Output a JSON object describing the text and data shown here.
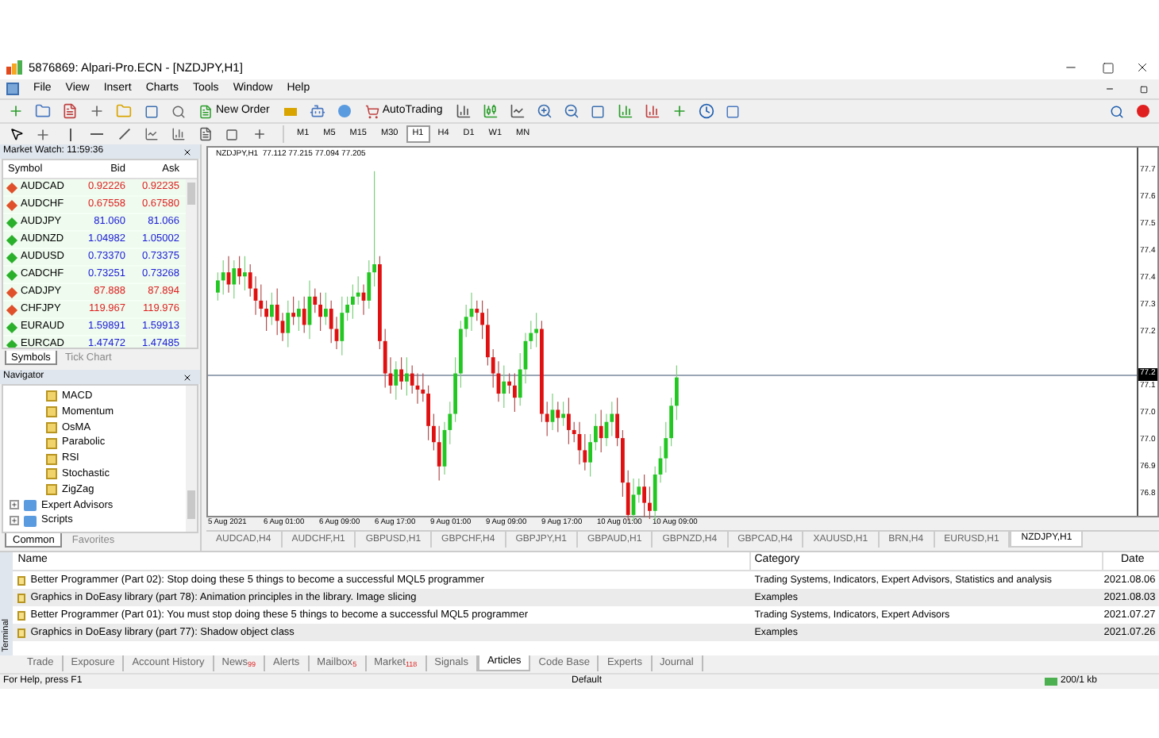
{
  "window": {
    "title": "5876869: Alpari-Pro.ECN - [NZDJPY,H1]"
  },
  "menu": [
    "File",
    "View",
    "Insert",
    "Charts",
    "Tools",
    "Window",
    "Help"
  ],
  "toolbar": {
    "buttons": [
      "New Order",
      "AutoTrading"
    ]
  },
  "timeframes": [
    {
      "label": "M1",
      "selected": false
    },
    {
      "label": "M5",
      "selected": false
    },
    {
      "label": "M15",
      "selected": false
    },
    {
      "label": "M30",
      "selected": false
    },
    {
      "label": "H1",
      "selected": true
    },
    {
      "label": "H4",
      "selected": false
    },
    {
      "label": "D1",
      "selected": false
    },
    {
      "label": "W1",
      "selected": false
    },
    {
      "label": "MN",
      "selected": false
    }
  ],
  "market_watch": {
    "title": "Market Watch: 11:59:36",
    "columns": [
      "Symbol",
      "Bid",
      "Ask"
    ],
    "rows": [
      {
        "symbol": "AUDCAD",
        "bid": "0.92226",
        "ask": "0.92235",
        "rising": false
      },
      {
        "symbol": "AUDCHF",
        "bid": "0.67558",
        "ask": "0.67580",
        "rising": false
      },
      {
        "symbol": "AUDJPY",
        "bid": "81.060",
        "ask": "81.066",
        "rising": true
      },
      {
        "symbol": "AUDNZD",
        "bid": "1.04982",
        "ask": "1.05002",
        "rising": true
      },
      {
        "symbol": "AUDUSD",
        "bid": "0.73370",
        "ask": "0.73375",
        "rising": true
      },
      {
        "symbol": "CADCHF",
        "bid": "0.73251",
        "ask": "0.73268",
        "rising": true
      },
      {
        "symbol": "CADJPY",
        "bid": "87.888",
        "ask": "87.894",
        "rising": false
      },
      {
        "symbol": "CHFJPY",
        "bid": "119.967",
        "ask": "119.976",
        "rising": false
      },
      {
        "symbol": "EURAUD",
        "bid": "1.59891",
        "ask": "1.59913",
        "rising": true
      },
      {
        "symbol": "EURCAD",
        "bid": "1.47472",
        "ask": "1.47485",
        "rising": true
      }
    ],
    "tabs": [
      {
        "label": "Symbols",
        "selected": true
      },
      {
        "label": "Tick Chart",
        "selected": false
      }
    ]
  },
  "navigator": {
    "title": "Navigator",
    "items": [
      {
        "label": "MACD",
        "kind": "indicator"
      },
      {
        "label": "Momentum",
        "kind": "indicator"
      },
      {
        "label": "OsMA",
        "kind": "indicator"
      },
      {
        "label": "Parabolic",
        "kind": "indicator"
      },
      {
        "label": "RSI",
        "kind": "indicator"
      },
      {
        "label": "Stochastic",
        "kind": "indicator"
      },
      {
        "label": "ZigZag",
        "kind": "indicator"
      },
      {
        "label": "Expert Advisors",
        "kind": "folder",
        "expanded": false
      },
      {
        "label": "Scripts",
        "kind": "folder",
        "expanded": false
      }
    ],
    "tabs": [
      {
        "label": "Common",
        "selected": true
      },
      {
        "label": "Favorites",
        "selected": false
      }
    ]
  },
  "chart": {
    "legend": "NZDJPY,H1  77.112 77.215 77.094 77.205",
    "price_labels": [
      "77.7",
      "77.6",
      "77.5",
      "77.4",
      "77.4",
      "77.3",
      "77.2",
      "77.1",
      "77.0",
      "77.0",
      "76.9",
      "76.8"
    ],
    "current_price": "77.2",
    "time_labels": [
      "5 Aug 2021",
      "6 Aug 01:00",
      "6 Aug 09:00",
      "6 Aug 17:00",
      "9 Aug 01:00",
      "9 Aug 09:00",
      "9 Aug 17:00",
      "10 Aug 01:00",
      "10 Aug 09:00"
    ],
    "tabs": [
      {
        "label": "AUDCAD,H4",
        "selected": false
      },
      {
        "label": "AUDCHF,H1",
        "selected": false
      },
      {
        "label": "GBPUSD,H1",
        "selected": false
      },
      {
        "label": "GBPCHF,H4",
        "selected": false
      },
      {
        "label": "GBPJPY,H1",
        "selected": false
      },
      {
        "label": "GBPAUD,H1",
        "selected": false
      },
      {
        "label": "GBPNZD,H4",
        "selected": false
      },
      {
        "label": "GBPCAD,H4",
        "selected": false
      },
      {
        "label": "XAUUSD,H1",
        "selected": false
      },
      {
        "label": "BRN,H4",
        "selected": false
      },
      {
        "label": "EURUSD,H1",
        "selected": false
      },
      {
        "label": "NZDJPY,H1",
        "selected": true
      }
    ]
  },
  "terminal": {
    "label": "Terminal",
    "columns": [
      "Name",
      "Category",
      "Date"
    ],
    "rows": [
      {
        "name": "Better Programmer (Part 02): Stop doing these 5 things to become a successful MQL5 programmer",
        "category": "Trading Systems, Indicators, Expert Advisors, Statistics and analysis",
        "date": "2021.08.06"
      },
      {
        "name": "Graphics in DoEasy library (part 78): Animation principles in the library. Image slicing",
        "category": "Examples",
        "date": "2021.08.03"
      },
      {
        "name": "Better Programmer (Part 01): You must stop doing these 5 things to become a successful MQL5 programmer",
        "category": "Trading Systems, Indicators, Expert Advisors",
        "date": "2021.07.27"
      },
      {
        "name": "Graphics in DoEasy library (part 77): Shadow object class",
        "category": "Examples",
        "date": "2021.07.26"
      }
    ],
    "tabs": [
      {
        "label": "Trade",
        "selected": false
      },
      {
        "label": "Exposure",
        "selected": false
      },
      {
        "label": "Account History",
        "selected": false
      },
      {
        "label": "News",
        "badge": "99",
        "selected": false
      },
      {
        "label": "Alerts",
        "selected": false
      },
      {
        "label": "Mailbox",
        "badge": "5",
        "selected": false
      },
      {
        "label": "Market",
        "badge": "118",
        "selected": false
      },
      {
        "label": "Signals",
        "selected": false
      },
      {
        "label": "Articles",
        "selected": true
      },
      {
        "label": "Code Base",
        "selected": false
      },
      {
        "label": "Experts",
        "selected": false
      },
      {
        "label": "Journal",
        "selected": false
      }
    ]
  },
  "status_bar": [
    "For Help, press F1",
    "Default",
    "200/1 kb"
  ]
}
